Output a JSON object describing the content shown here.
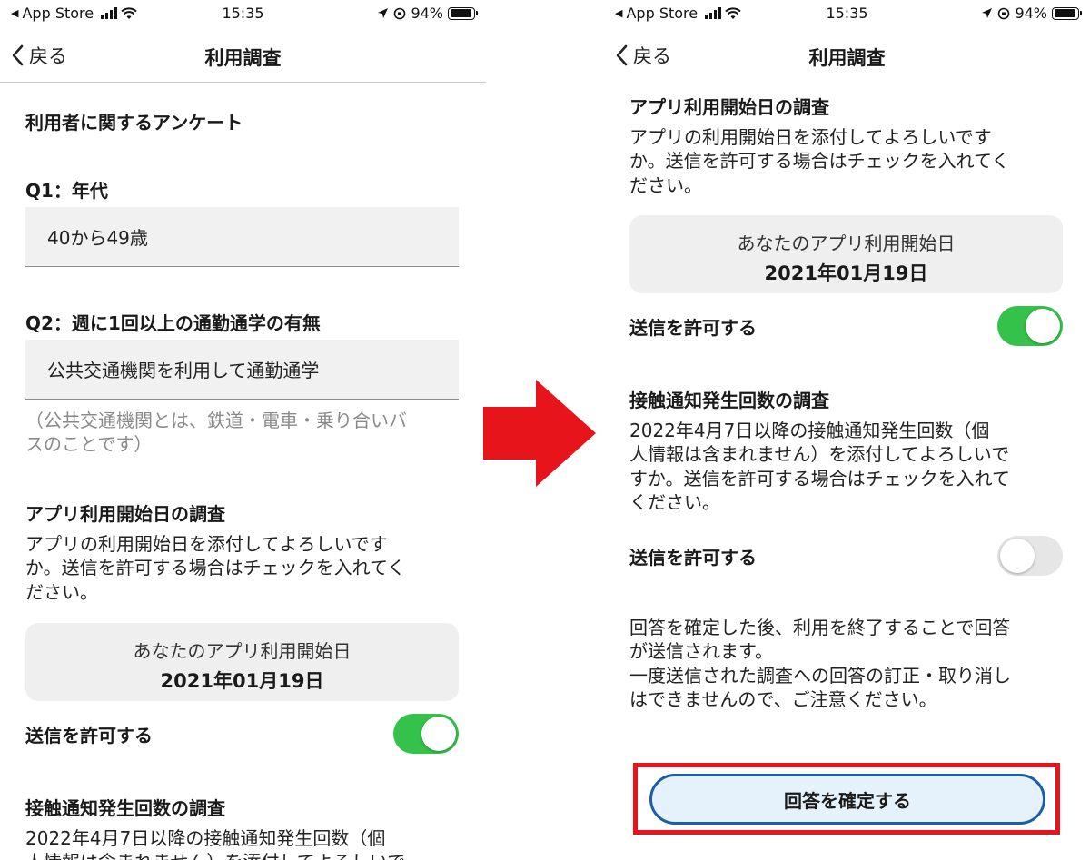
{
  "status_bar": {
    "carrier": "App Store",
    "time": "15:35",
    "battery_percent": "94%",
    "battery_level": 0.94
  },
  "nav": {
    "back_label": "戻る",
    "title": "利用調査"
  },
  "left_screen": {
    "section_title": "利用者に関するアンケート",
    "q1": {
      "label": "Q1：年代",
      "value": "40から49歳"
    },
    "q2": {
      "label": "Q2：週に1回以上の通勤通学の有無",
      "value": "公共交通機関を利用して通勤通学",
      "note_line1": "（公共交通機関とは、鉄道・電車・乗り合いバ",
      "note_line2": "スのことです）"
    },
    "start_date_section": {
      "heading": "アプリ利用開始日の調査",
      "desc_line1": "アプリの利用開始日を添付してよろしいです",
      "desc_line2": "か。送信を許可する場合はチェックを入れてく",
      "desc_line3": "ださい。",
      "card_label": "あなたのアプリ利用開始日",
      "card_value": "2021年01月19日",
      "toggle_label": "送信を許可する",
      "toggle_on": true
    },
    "contact_section": {
      "heading": "接触通知発生回数の調査",
      "desc_line1": "2022年4月7日以降の接触通知発生回数（個",
      "desc_line2": "人情報は含まれません）を添付してよろしいで"
    }
  },
  "right_screen": {
    "start_date_section": {
      "heading": "アプリ利用開始日の調査",
      "desc_line1": "アプリの利用開始日を添付してよろしいです",
      "desc_line2": "か。送信を許可する場合はチェックを入れてく",
      "desc_line3": "ださい。",
      "card_label": "あなたのアプリ利用開始日",
      "card_value": "2021年01月19日",
      "toggle_label": "送信を許可する",
      "toggle_on": true
    },
    "contact_section": {
      "heading": "接触通知発生回数の調査",
      "desc_line1": "2022年4月7日以降の接触通知発生回数（個",
      "desc_line2": "人情報は含まれません）を添付してよろしいで",
      "desc_line3": "すか。送信を許可する場合はチェックを入れて",
      "desc_line4": "ください。",
      "toggle_label": "送信を許可する",
      "toggle_on": false
    },
    "notice": {
      "line1": "回答を確定した後、利用を終了することで回答",
      "line2": "が送信されます。",
      "line3": "一度送信された調査への回答の訂正・取り消し",
      "line4": "はできませんので、ご注意ください。"
    },
    "confirm_button_label": "回答を確定する"
  },
  "colors": {
    "toggle_on": "#34c24a",
    "toggle_off": "#e6e6e6",
    "highlight_frame": "#e8141c",
    "arrow": "#e8141c",
    "button_border": "#1c5ea8",
    "button_fill": "#e6f2fb"
  },
  "icons": [
    "back-chevron-icon",
    "signal-icon",
    "wifi-icon",
    "location-arrow-icon",
    "orientation-lock-icon",
    "battery-icon",
    "right-arrow-icon"
  ]
}
